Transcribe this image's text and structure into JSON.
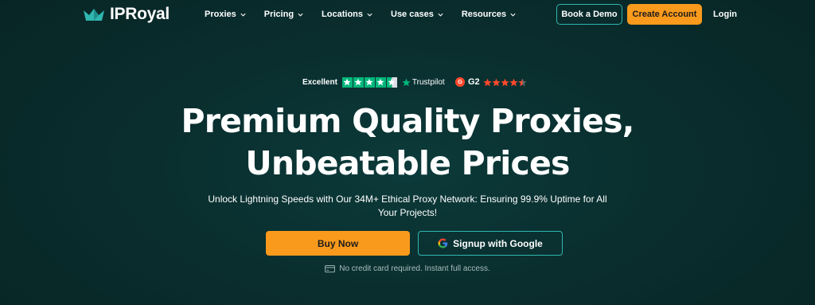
{
  "header": {
    "logo_text": "IPRoyal",
    "nav": [
      {
        "label": "Proxies",
        "icon": "chevron-down-icon"
      },
      {
        "label": "Pricing",
        "icon": "chevron-down-icon"
      },
      {
        "label": "Locations",
        "icon": "chevron-down-icon"
      },
      {
        "label": "Use cases",
        "icon": "chevron-down-icon"
      },
      {
        "label": "Resources",
        "icon": "chevron-down-icon"
      }
    ],
    "book_demo_label": "Book a Demo",
    "create_account_label": "Create Account",
    "login_label": "Login"
  },
  "ratings": {
    "trustpilot_label": "Excellent",
    "trustpilot_brand": "Trustpilot",
    "trustpilot_stars": 4.5,
    "g2_label": "G2",
    "g2_stars": 4.5
  },
  "hero": {
    "title_line1": "Premium Quality Proxies,",
    "title_line2": "Unbeatable Prices",
    "subtitle": "Unlock Lightning Speeds with Our 34M+ Ethical Proxy Network: Ensuring 99.9% Uptime for All Your Projects!",
    "buy_now_label": "Buy Now",
    "google_signup_label": "Signup with Google",
    "note": "No credit card required. Instant full access."
  },
  "colors": {
    "background": "#0a2e2e",
    "accent_orange": "#f99a1c",
    "accent_teal": "#2fb6b0",
    "trustpilot_green": "#00b67a",
    "g2_red": "#ff492c"
  }
}
